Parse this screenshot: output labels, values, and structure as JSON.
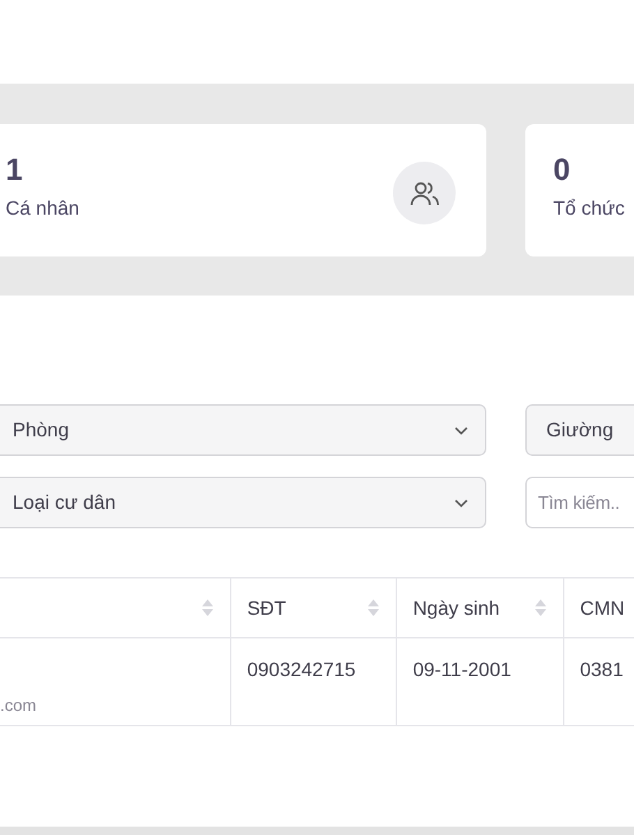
{
  "stats": [
    {
      "value": "1",
      "label": "Cá nhân",
      "icon": true
    },
    {
      "value": "0",
      "label": "Tổ chức",
      "icon": false
    }
  ],
  "filters": [
    {
      "kind": "select",
      "value": "Phòng"
    },
    {
      "kind": "select",
      "value": "Giường"
    },
    {
      "kind": "select",
      "value": "Loại cư dân"
    },
    {
      "kind": "search",
      "placeholder": "Tìm kiếm.."
    }
  ],
  "table": {
    "columns": [
      {
        "sortable": true
      },
      {
        "label": "SĐT",
        "sortable": true
      },
      {
        "label": "Ngày sinh",
        "sortable": true
      },
      {
        "label": "CMN",
        "sortable": false
      }
    ],
    "rows": [
      {
        "cells": [
          {
            "secondary": ".com"
          },
          {
            "text": "0903242715"
          },
          {
            "text": "09-11-2001"
          },
          {
            "text": "0381"
          }
        ]
      }
    ]
  }
}
